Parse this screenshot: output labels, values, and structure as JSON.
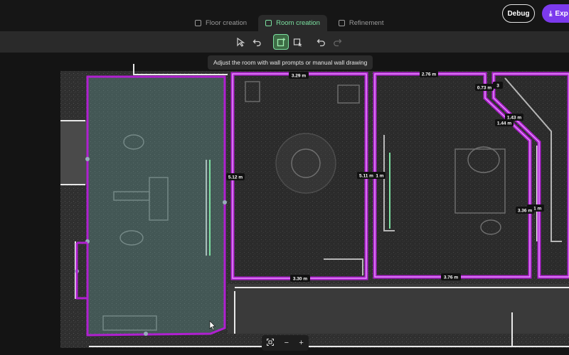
{
  "header": {
    "tabs": [
      {
        "label": "Floor creation"
      },
      {
        "label": "Room creation"
      },
      {
        "label": "Refinement"
      }
    ],
    "debug_label": "Debug",
    "export_label": "Exp"
  },
  "toolbar": {
    "tooltip": "Adjust the room with wall prompts or manual wall drawing"
  },
  "measurements": {
    "r2_top": "3.29 m",
    "r2_left": "5.12 m",
    "r2_right": "5.11 m",
    "r2_bottom": "3.30 m",
    "r3_top": "2.76 m",
    "r3_bottom": "3.76 m",
    "r3_diag1": "0.73 m",
    "r3_diag2": "1.43 m",
    "r3_diag3": "1.44 m",
    "r3_right": "3.36 m",
    "r3_right_b": "3.1 m",
    "r3_diag_b": "3",
    "r3_left_b": "1 m"
  },
  "zoom": {
    "minus": "−",
    "plus": "+"
  },
  "colors": {
    "accent": "#7be0a0",
    "room_outline": "#b020d0",
    "brand": "#7c3aed"
  }
}
